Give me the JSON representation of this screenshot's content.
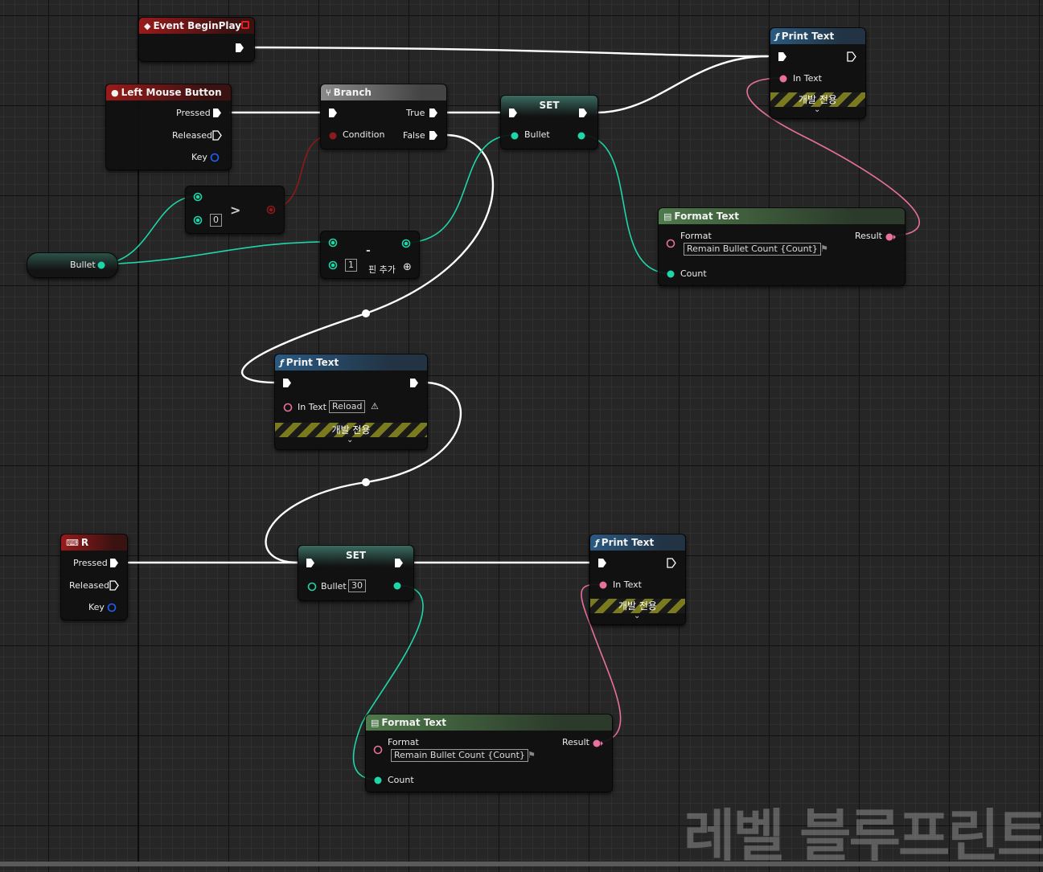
{
  "nodes": {
    "event_begin_play": {
      "title": "Event BeginPlay"
    },
    "print_text_1": {
      "title": "Print Text",
      "in_text_label": "In Text",
      "dev_label": "개발 전용"
    },
    "left_mouse": {
      "title": "Left Mouse Button",
      "pressed": "Pressed",
      "released": "Released",
      "key": "Key"
    },
    "branch": {
      "title": "Branch",
      "true": "True",
      "false": "False",
      "condition": "Condition"
    },
    "set_1": {
      "title": "SET",
      "bullet": "Bullet"
    },
    "greater": {
      "op": ">",
      "value": "0"
    },
    "bullet_get": {
      "label": "Bullet"
    },
    "subtract": {
      "op": "-",
      "value": "1",
      "add_pin": "핀 추가"
    },
    "format_text_1": {
      "title": "Format Text",
      "format": "Format",
      "format_value": "Remain Bullet Count {Count}",
      "result": "Result",
      "count": "Count"
    },
    "print_text_2": {
      "title": "Print Text",
      "in_text_label": "In Text",
      "in_text_value": "Reload",
      "dev_label": "개발 전용"
    },
    "r_key": {
      "title": "R",
      "pressed": "Pressed",
      "released": "Released",
      "key": "Key"
    },
    "set_2": {
      "title": "SET",
      "bullet": "Bullet",
      "bullet_value": "30"
    },
    "print_text_3": {
      "title": "Print Text",
      "in_text_label": "In Text",
      "dev_label": "개발 전용"
    },
    "format_text_2": {
      "title": "Format Text",
      "format": "Format",
      "format_value": "Remain Bullet Count {Count}",
      "result": "Result",
      "count": "Count"
    }
  },
  "watermark": "레벨 블루프린트",
  "colors": {
    "exec_wire": "#ffffff",
    "int_pin": "#1fd6a9",
    "text_pin": "#e8709c",
    "bool_pin": "#8b1a1a",
    "struct_pin": "#2060ff"
  },
  "icons": {
    "event": "event-diamond-icon",
    "function": "function-f-icon",
    "branch": "branch-icon",
    "mouse": "mouse-icon",
    "keyboard": "keyboard-icon",
    "format": "format-text-icon"
  }
}
